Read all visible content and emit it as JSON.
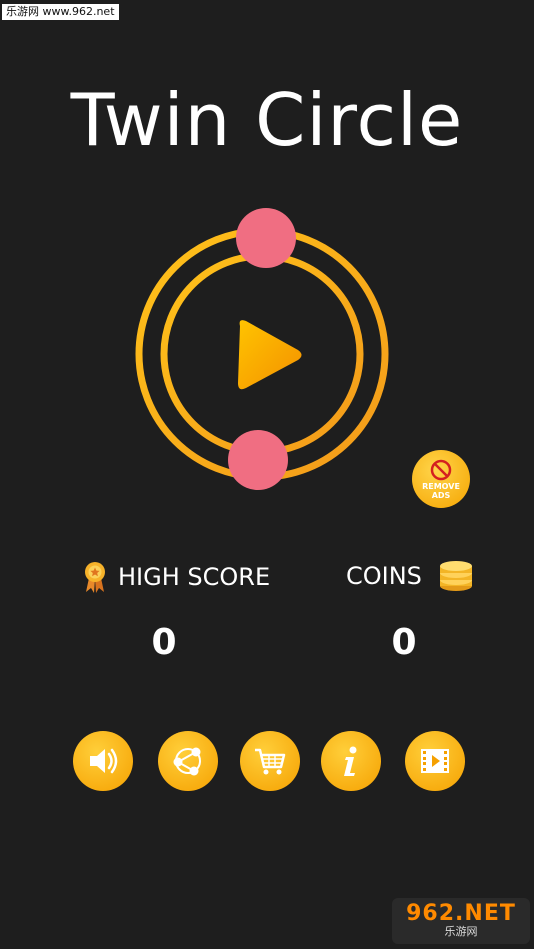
{
  "watermark": {
    "top_text": "乐游网 www.962.net",
    "bottom_brand": "962.NET",
    "bottom_sub": "乐游网"
  },
  "title": "Twin Circle",
  "play": {
    "icon": "play-icon"
  },
  "remove_ads": {
    "icon": "no-ads-icon",
    "line1": "REMOVE",
    "line2": "ADS"
  },
  "stats": {
    "high_score_label": "HIGH SCORE",
    "high_score_value": "0",
    "coins_label": "COINS",
    "coins_value": "0"
  },
  "toolbar": [
    "sound-icon",
    "share-icon",
    "cart-icon",
    "info-icon",
    "video-icon"
  ],
  "colors": {
    "background": "#1e1e1e",
    "ring": "#f5b400",
    "dot": "#f06e82",
    "button": "#f7b000"
  }
}
